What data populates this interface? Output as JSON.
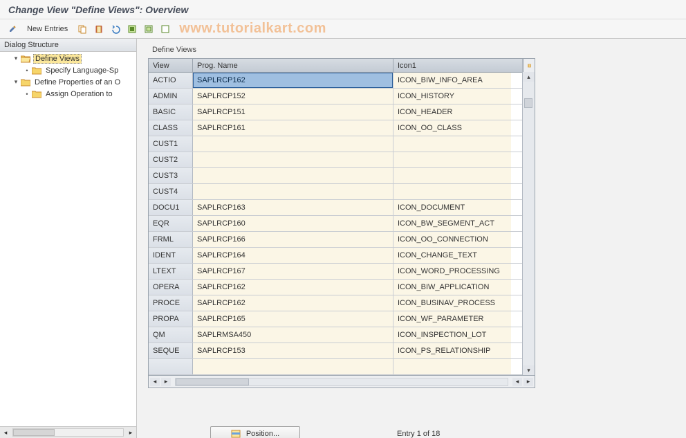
{
  "title": "Change View \"Define Views\": Overview",
  "watermark": "www.tutorialkart.com",
  "toolbar": {
    "new_entries_label": "New Entries"
  },
  "sidebar": {
    "header": "Dialog Structure",
    "items": [
      {
        "label": "Define Views",
        "expanded": true,
        "selected": true,
        "level": 1
      },
      {
        "label": "Specify Language-Sp",
        "expanded": false,
        "selected": false,
        "level": 2
      },
      {
        "label": "Define Properties of an O",
        "expanded": true,
        "selected": false,
        "level": 1
      },
      {
        "label": "Assign Operation to",
        "expanded": false,
        "selected": false,
        "level": 2
      }
    ]
  },
  "panel": {
    "title": "Define Views",
    "columns": {
      "view": "View",
      "prog": "Prog. Name",
      "icon1": "Icon1"
    },
    "rows": [
      {
        "view": "ACTIO",
        "prog": "SAPLRCP162",
        "icon1": "ICON_BIW_INFO_AREA",
        "selected": true
      },
      {
        "view": "ADMIN",
        "prog": "SAPLRCP152",
        "icon1": "ICON_HISTORY"
      },
      {
        "view": "BASIC",
        "prog": "SAPLRCP151",
        "icon1": "ICON_HEADER"
      },
      {
        "view": "CLASS",
        "prog": "SAPLRCP161",
        "icon1": "ICON_OO_CLASS"
      },
      {
        "view": "CUST1",
        "prog": "",
        "icon1": ""
      },
      {
        "view": "CUST2",
        "prog": "",
        "icon1": ""
      },
      {
        "view": "CUST3",
        "prog": "",
        "icon1": ""
      },
      {
        "view": "CUST4",
        "prog": "",
        "icon1": ""
      },
      {
        "view": "DOCU1",
        "prog": "SAPLRCP163",
        "icon1": "ICON_DOCUMENT"
      },
      {
        "view": "EQR",
        "prog": "SAPLRCP160",
        "icon1": "ICON_BW_SEGMENT_ACT"
      },
      {
        "view": "FRML",
        "prog": "SAPLRCP166",
        "icon1": "ICON_OO_CONNECTION"
      },
      {
        "view": "IDENT",
        "prog": "SAPLRCP164",
        "icon1": "ICON_CHANGE_TEXT"
      },
      {
        "view": "LTEXT",
        "prog": "SAPLRCP167",
        "icon1": "ICON_WORD_PROCESSING"
      },
      {
        "view": "OPERA",
        "prog": "SAPLRCP162",
        "icon1": "ICON_BIW_APPLICATION"
      },
      {
        "view": "PROCE",
        "prog": "SAPLRCP162",
        "icon1": "ICON_BUSINAV_PROCESS"
      },
      {
        "view": "PROPA",
        "prog": "SAPLRCP165",
        "icon1": "ICON_WF_PARAMETER"
      },
      {
        "view": "QM",
        "prog": "SAPLRMSA450",
        "icon1": "ICON_INSPECTION_LOT"
      },
      {
        "view": "SEQUE",
        "prog": "SAPLRCP153",
        "icon1": "ICON_PS_RELATIONSHIP"
      },
      {
        "view": "",
        "prog": "",
        "icon1": ""
      }
    ]
  },
  "footer": {
    "position_label": "Position...",
    "entry_status": "Entry 1 of 18"
  }
}
